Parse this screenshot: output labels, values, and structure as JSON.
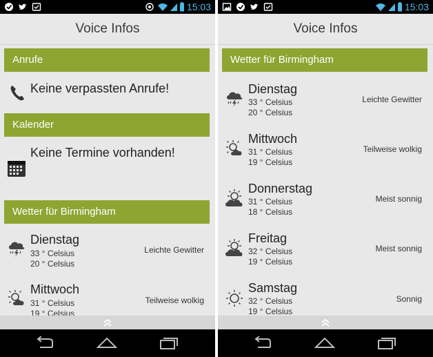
{
  "status_bar": {
    "time": "15:03"
  },
  "app": {
    "title": "Voice Infos"
  },
  "left_screen": {
    "calls": {
      "header": "Anrufe",
      "message": "Keine verpassten Anrufe!"
    },
    "calendar": {
      "header": "Kalender",
      "message": "Keine Termine vorhanden!"
    },
    "weather": {
      "header": "Wetter für Birmingham",
      "days": [
        {
          "day": "Dienstag",
          "high": "33 ° Celsius",
          "low": "20 ° Celsius",
          "condition": "Leichte Gewitter",
          "icon": "thunderstorm-icon"
        },
        {
          "day": "Mittwoch",
          "high": "31 ° Celsius",
          "low": "19 ° Celsius",
          "condition": "Teilweise wolkig",
          "icon": "partly-cloudy-icon"
        }
      ]
    }
  },
  "right_screen": {
    "weather": {
      "header": "Wetter für Birmingham",
      "days": [
        {
          "day": "Dienstag",
          "high": "33 ° Celsius",
          "low": "20 ° Celsius",
          "condition": "Leichte Gewitter",
          "icon": "thunderstorm-icon"
        },
        {
          "day": "Mittwoch",
          "high": "31 ° Celsius",
          "low": "19 ° Celsius",
          "condition": "Teilweise wolkig",
          "icon": "partly-cloudy-icon"
        },
        {
          "day": "Donnerstag",
          "high": "31 ° Celsius",
          "low": "18 ° Celsius",
          "condition": "Meist sonnig",
          "icon": "mostly-sunny-icon"
        },
        {
          "day": "Freitag",
          "high": "32 ° Celsius",
          "low": "19 ° Celsius",
          "condition": "Meist sonnig",
          "icon": "mostly-sunny-icon"
        },
        {
          "day": "Samstag",
          "high": "32 ° Celsius",
          "low": "19 ° Celsius",
          "condition": "Sonnig",
          "icon": "sunny-icon"
        }
      ]
    }
  },
  "colors": {
    "accent": "#8ea532",
    "clock": "#4fb6e6",
    "background": "#e8e8e8"
  }
}
